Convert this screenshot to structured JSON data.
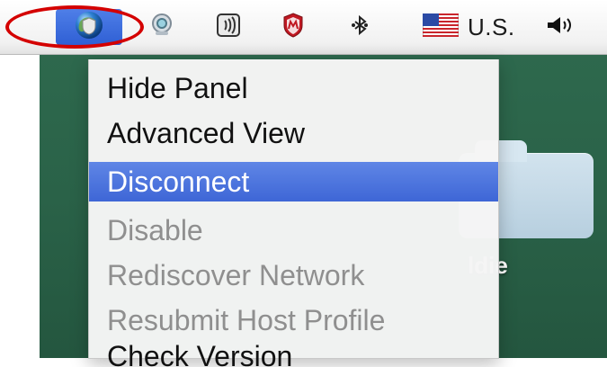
{
  "menubar": {
    "region_label": "U.S.",
    "colors": {
      "active_item_bg": "#2f5fd4",
      "highlight_circle": "#d40000"
    },
    "icons": [
      "globe-shield-icon",
      "webcam-icon",
      "audio-badge-icon",
      "mcafee-shield-icon",
      "bluetooth-icon",
      "us-flag-icon",
      "volume-icon"
    ]
  },
  "menu": {
    "items": [
      {
        "label": "Hide Panel",
        "state": "enabled"
      },
      {
        "label": "Advanced View",
        "state": "enabled"
      },
      {
        "label": "Disconnect",
        "state": "selected"
      },
      {
        "label": "Disable",
        "state": "disabled"
      },
      {
        "label": "Rediscover Network",
        "state": "disabled"
      },
      {
        "label": "Resubmit Host Profile",
        "state": "disabled"
      },
      {
        "label": "Check Version",
        "state": "enabled"
      }
    ]
  },
  "desktop": {
    "folder_label": "ldie"
  }
}
